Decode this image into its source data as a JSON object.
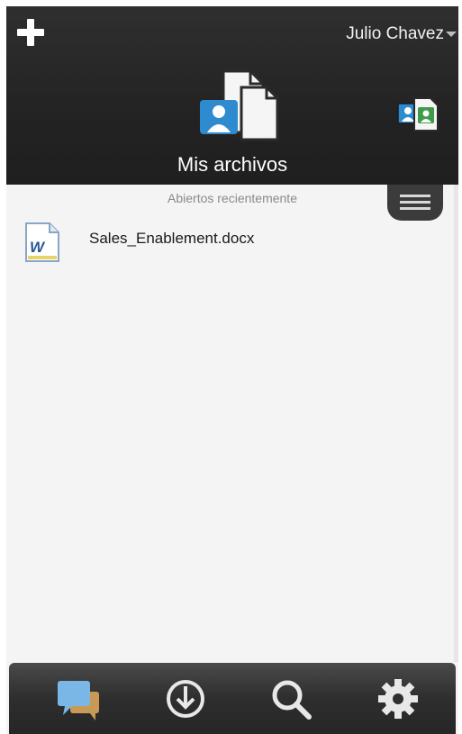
{
  "header": {
    "user_name": "Julio Chavez",
    "section_title": "Mis archivos"
  },
  "content": {
    "recent_label": "Abiertos recientemente",
    "files": [
      {
        "name": "Sales_Enablement.docx",
        "icon": "word-doc-icon"
      }
    ]
  },
  "toolbar": {
    "items": [
      {
        "icon": "chat-icon"
      },
      {
        "icon": "download-icon"
      },
      {
        "icon": "search-icon"
      },
      {
        "icon": "gear-icon"
      }
    ]
  },
  "colors": {
    "header_bg": "#232323",
    "content_bg": "#f4f4f4",
    "accent_blue": "#2e8bd0",
    "accent_green": "#3f9b4a"
  }
}
